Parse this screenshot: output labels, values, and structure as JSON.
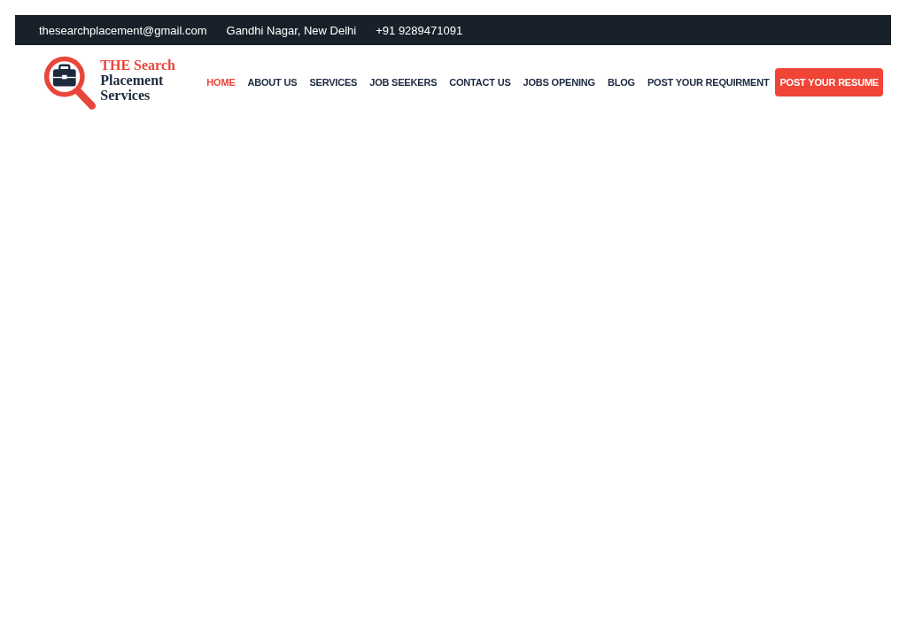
{
  "topbar": {
    "email": "thesearchplacement@gmail.com",
    "address": "Gandhi Nagar, New Delhi",
    "phone": "+91 9289471091"
  },
  "logo": {
    "line_1": "THE Search",
    "line_2": "Placement Services"
  },
  "nav": [
    {
      "label": "HOME",
      "selected": true
    },
    {
      "label": "ABOUT US",
      "selected": false
    },
    {
      "label": "SERVICES",
      "selected": false
    },
    {
      "label": "JOB SEEKERS",
      "selected": false
    },
    {
      "label": "CONTACT US",
      "selected": false
    },
    {
      "label": "JOBS OPENING",
      "selected": false
    },
    {
      "label": "BLOG",
      "selected": false
    },
    {
      "label": "POST YOUR REQUIRMENT",
      "selected": false
    }
  ],
  "cta_button": "POST YOUR RESUME"
}
